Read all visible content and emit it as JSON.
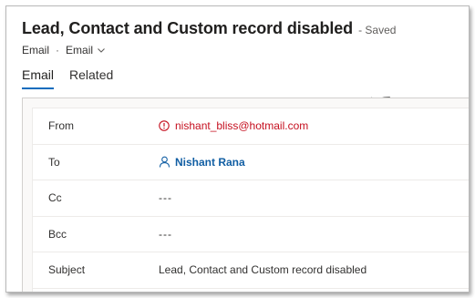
{
  "header": {
    "title": "Lead, Contact and Custom record disabled",
    "saved_status": "- Saved",
    "entity_name": "Email",
    "separator": "·",
    "form_name": "Email"
  },
  "tabs": [
    {
      "label": "Email",
      "active": true
    },
    {
      "label": "Related",
      "active": false
    }
  ],
  "fields": {
    "from": {
      "label": "From",
      "value": "nishant_bliss@hotmail.com",
      "icon": "warning-circle-icon"
    },
    "to": {
      "label": "To",
      "value": "Nishant Rana",
      "icon": "person-icon"
    },
    "cc": {
      "label": "Cc",
      "value": "---"
    },
    "bcc": {
      "label": "Bcc",
      "value": "---"
    },
    "subject": {
      "label": "Subject",
      "value": "Lead, Contact and Custom record disabled"
    }
  },
  "colors": {
    "accent": "#0f6cbd",
    "error": "#c50f1f",
    "link": "#115ea3"
  }
}
